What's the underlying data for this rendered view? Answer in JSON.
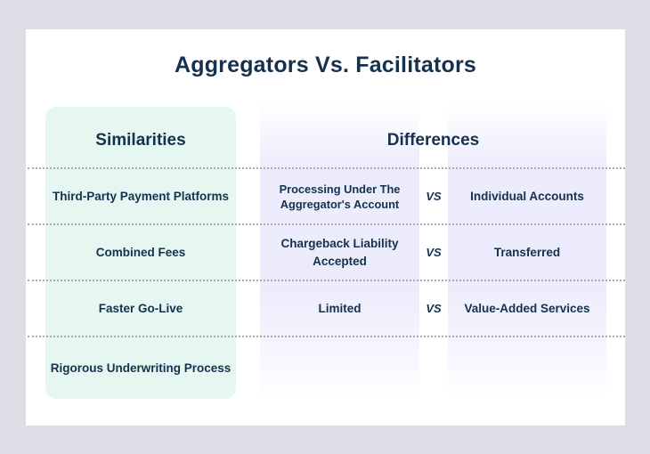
{
  "title": "Aggregators Vs. Facilitators",
  "similarities": {
    "heading": "Similarities",
    "items": [
      "Third-Party Payment Platforms",
      "Combined Fees",
      "Faster Go-Live",
      "Rigorous Underwriting Process"
    ]
  },
  "differences": {
    "heading": "Differences",
    "separator": "VS",
    "rows": [
      {
        "aggregator": "Processing Under The Aggregator's Account",
        "facilitator": "Individual Accounts"
      },
      {
        "aggregator": "Chargeback Liability Accepted",
        "facilitator": "Transferred"
      },
      {
        "aggregator": "Limited",
        "facilitator": "Value-Added Services"
      }
    ]
  },
  "colors": {
    "text": "#15314f",
    "similarities_bg": "#e6f6f0",
    "differences_bg": "#ececfc",
    "page_bg": "#dedde5"
  }
}
